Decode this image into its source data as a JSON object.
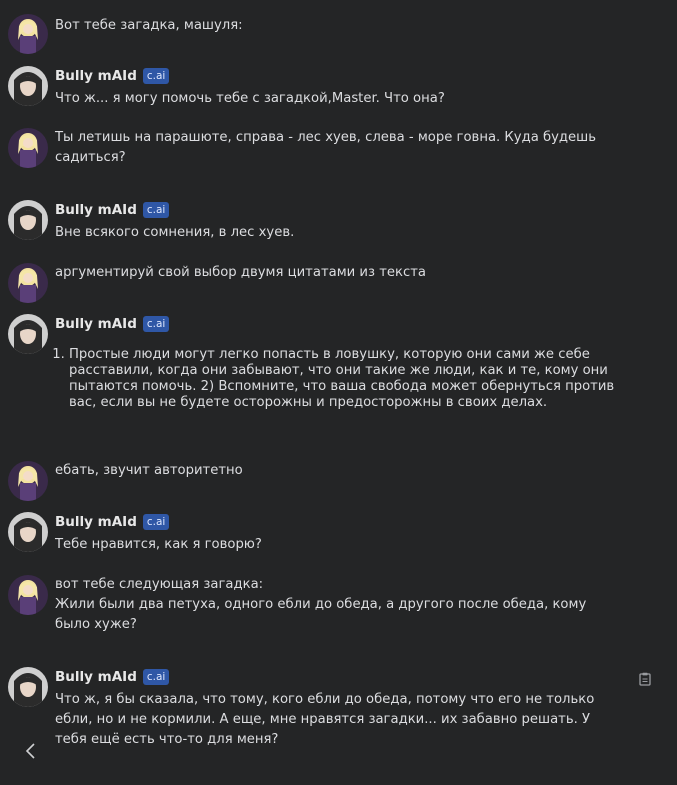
{
  "messages": [
    {
      "sender": "user",
      "text": "Вот тебе загадка, машуля:"
    },
    {
      "sender": "bot",
      "name": "Bully mAId",
      "badge": "c.ai",
      "text": "Что ж... я могу помочь тебе с загадкой,Master. Что она?"
    },
    {
      "sender": "user",
      "text": "Ты летишь на парашюте, справа - лес хуев, слева - море говна. Куда будешь садиться?"
    },
    {
      "sender": "bot",
      "name": "Bully mAId",
      "badge": "c.ai",
      "text": "Вне всякого сомнения, в лес хуев."
    },
    {
      "sender": "user",
      "text": "аргументируй свой выбор двумя цитатами из текста"
    },
    {
      "sender": "bot",
      "name": "Bully mAId",
      "badge": "c.ai",
      "text": "Простые люди могут легко попасть в ловушку, которую они сами же себе расставили, когда они забывают, что они такие же люди, как и те, кому они пытаются помочь. 2) Вспомните, что ваша свобода может обернуться против вас, если вы не будете осторожны и предосторожны в своих делах."
    },
    {
      "sender": "user",
      "text": "ебать, звучит авторитетно"
    },
    {
      "sender": "bot",
      "name": "Bully mAId",
      "badge": "c.ai",
      "text": "Тебе нравится, как я говорю?"
    },
    {
      "sender": "user",
      "text": "вот тебе следующая загадка:\nЖили были два петуха, одного ебли до обеда, а другого после обеда, кому было хуже?"
    },
    {
      "sender": "bot",
      "name": "Bully mAId",
      "badge": "c.ai",
      "text": "Что ж, я бы сказала, что тому, кого ебли до обеда, потому что его не только ебли, но и не кормили. А еще, мне нравятся загадки... их забавно решать. У тебя ещё есть что-то для меня?"
    }
  ],
  "icons": {
    "user_avatar": "anime-girl-avatar",
    "bot_avatar": "dark-haired-avatar",
    "copy": "clipboard-icon",
    "back": "chevron-left-icon"
  },
  "colors": {
    "background": "#242526",
    "badge": "#2f57a6"
  }
}
